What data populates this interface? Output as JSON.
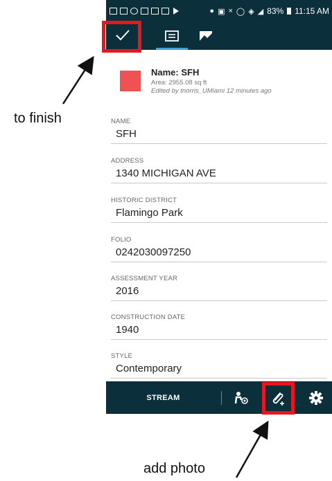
{
  "status_bar": {
    "battery": "83%",
    "time": "11:15 AM"
  },
  "feature": {
    "name": "Name: SFH",
    "area": "Area: 2955.08 sq ft",
    "edited": "Edited by tnorris_UMiami 12 minutes ago",
    "color": "#ee5252"
  },
  "fields": [
    {
      "label": "NAME",
      "value": "SFH"
    },
    {
      "label": "ADDRESS",
      "value": "1340 MICHIGAN AVE"
    },
    {
      "label": "HISTORIC DISTRICT",
      "value": "Flamingo Park"
    },
    {
      "label": "FOLIO",
      "value": "0242030097250"
    },
    {
      "label": "ASSESSMENT YEAR",
      "value": "2016"
    },
    {
      "label": "CONSTRUCTION DATE",
      "value": "1940"
    },
    {
      "label": "STYLE",
      "value": "Contemporary"
    }
  ],
  "bottom_bar": {
    "stream": "STREAM"
  },
  "annotations": {
    "finish": "to finish",
    "photo": "add photo",
    "highlight_color": "#e8161d"
  },
  "theme": {
    "bar": "#0c2f3c",
    "accent": "#3ba3dc"
  },
  "icons": [
    "check-icon",
    "list-icon",
    "map-icon",
    "track-location-icon",
    "attach-photo-icon",
    "gear-icon"
  ]
}
